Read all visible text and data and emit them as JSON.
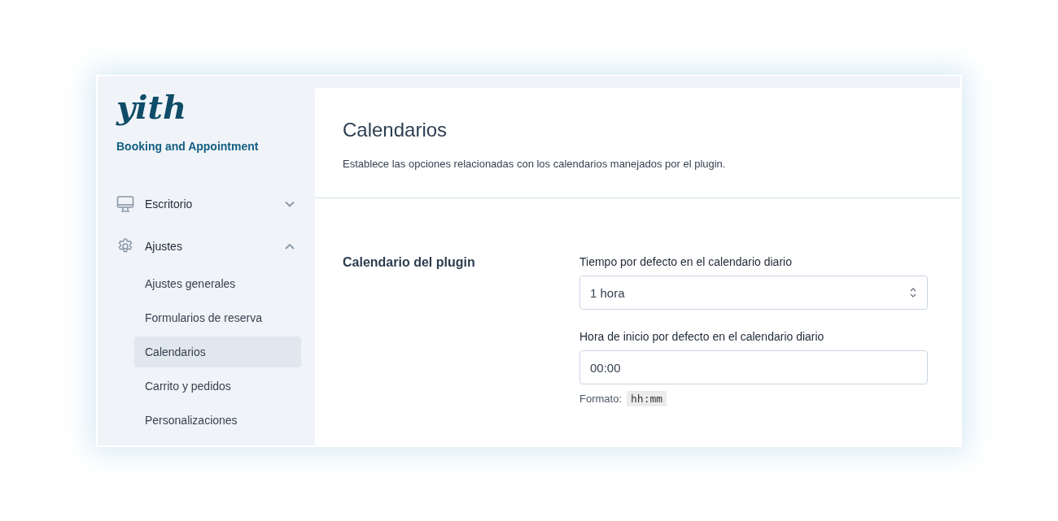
{
  "brand": {
    "logo": "yith",
    "subtitle": "Booking and Appointment"
  },
  "nav": [
    {
      "label": "Escritorio",
      "kind": "monitor",
      "expanded": false
    },
    {
      "label": "Ajustes",
      "kind": "gear",
      "expanded": true,
      "children": [
        {
          "label": "Ajustes generales",
          "selected": false
        },
        {
          "label": "Formularios de reserva",
          "selected": false
        },
        {
          "label": "Calendarios",
          "selected": true
        },
        {
          "label": "Carrito y pedidos",
          "selected": false
        },
        {
          "label": "Personalizaciones",
          "selected": false
        }
      ]
    }
  ],
  "page": {
    "title": "Calendarios",
    "description": "Establece las opciones relacionadas con los calendarios manejados por el plugin."
  },
  "section": {
    "title": "Calendario del plugin",
    "fields": [
      {
        "kind": "select",
        "label": "Tiempo por defecto en el calendario diario",
        "value": "1 hora"
      },
      {
        "kind": "text",
        "label": "Hora de inicio por defecto en el calendario diario",
        "value": "00:00",
        "help_label": "Formato:",
        "help_code": "hh:mm"
      }
    ]
  }
}
